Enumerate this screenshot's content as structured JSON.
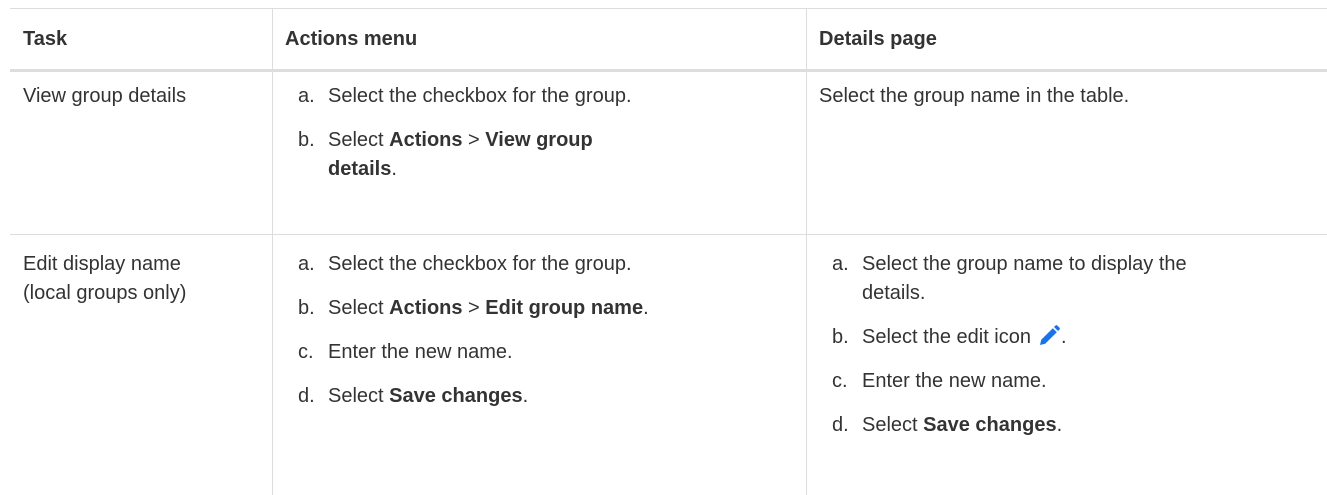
{
  "table": {
    "headers": {
      "task": "Task",
      "actions_menu": "Actions menu",
      "details_page": "Details page"
    },
    "rows": [
      {
        "task": "View group details",
        "actions_menu": {
          "steps": [
            {
              "marker": "a.",
              "text": "Select the checkbox for the group."
            },
            {
              "marker": "b.",
              "pre": "Select ",
              "bold1": "Actions",
              "sep": " > ",
              "bold2_line1": "View group",
              "bold2_line2": "details",
              "post": "."
            }
          ]
        },
        "details_page": {
          "text": "Select the group name in the table."
        }
      },
      {
        "task_line1": "Edit display name",
        "task_line2": "(local groups only)",
        "actions_menu": {
          "steps": [
            {
              "marker": "a.",
              "text": "Select the checkbox for the group."
            },
            {
              "marker": "b.",
              "pre": "Select ",
              "bold1": "Actions",
              "sep": " > ",
              "bold2": "Edit group name",
              "post": "."
            },
            {
              "marker": "c.",
              "text": "Enter the new name."
            },
            {
              "marker": "d.",
              "pre": "Select ",
              "bold": "Save changes",
              "post": "."
            }
          ]
        },
        "details_page": {
          "steps": [
            {
              "marker": "a.",
              "line1": "Select the group name to display the",
              "line2": "details."
            },
            {
              "marker": "b.",
              "pre": "Select the edit icon",
              "icon": "pencil-edit-icon",
              "post": "."
            },
            {
              "marker": "c.",
              "text": "Enter the new name."
            },
            {
              "marker": "d.",
              "pre": "Select ",
              "bold": "Save changes",
              "post": "."
            }
          ]
        }
      }
    ]
  },
  "colors": {
    "text": "#333333",
    "grid": "#dddddd",
    "edit_icon": "#1a73e8"
  }
}
